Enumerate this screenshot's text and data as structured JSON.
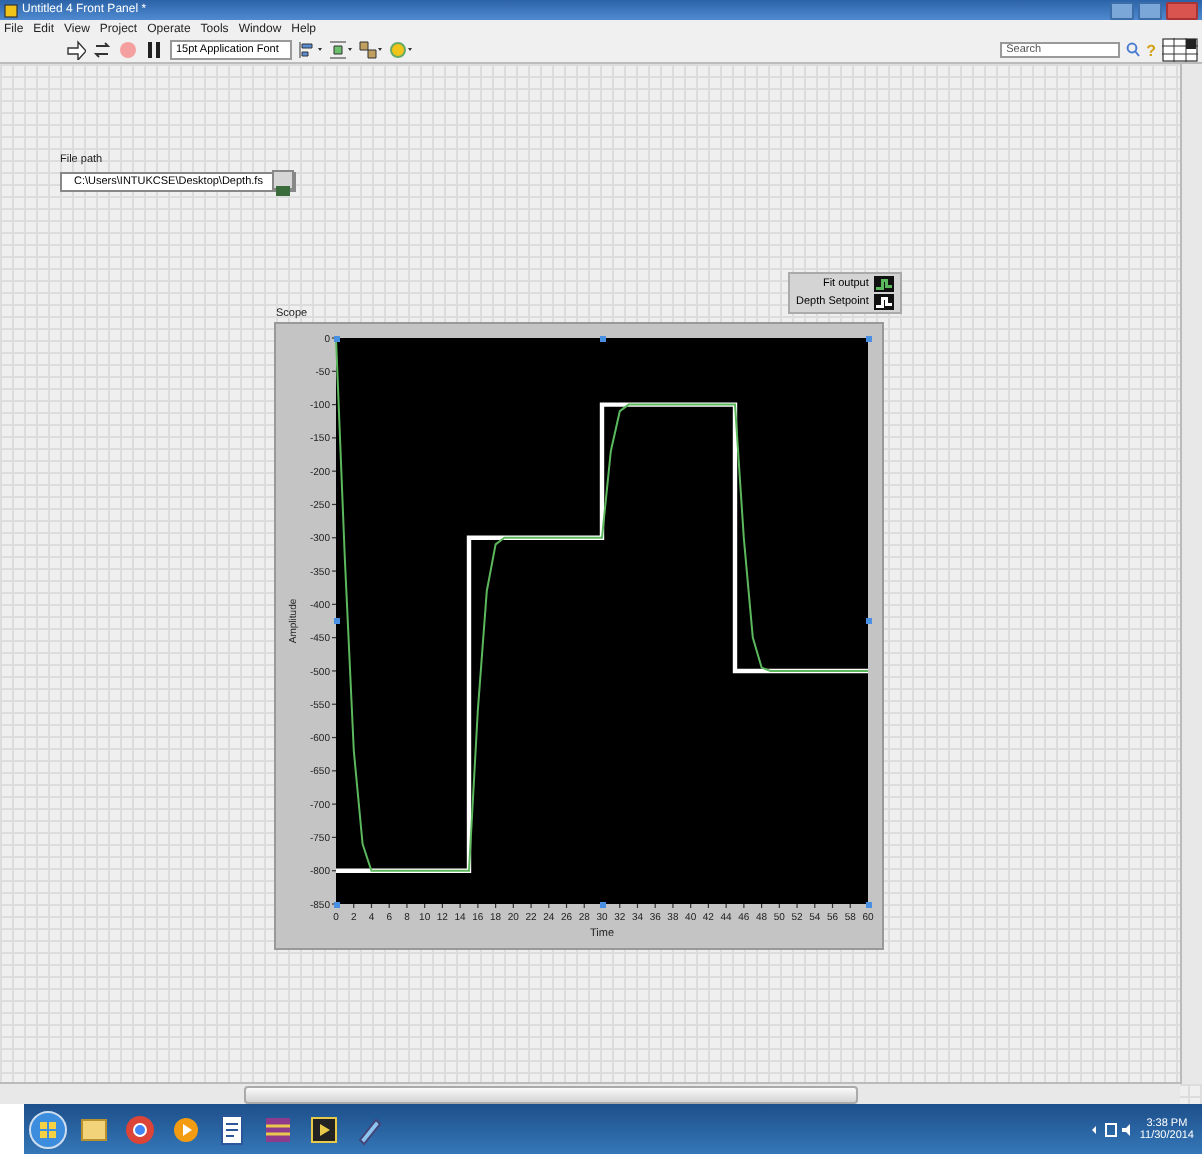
{
  "window": {
    "title": "Untitled 4 Front Panel *"
  },
  "menu": [
    "File",
    "Edit",
    "View",
    "Project",
    "Operate",
    "Tools",
    "Window",
    "Help"
  ],
  "toolbar": {
    "font": "15pt Application Font",
    "search": {
      "placeholder": "Search"
    },
    "help": "?"
  },
  "file_path": {
    "label": "File path",
    "value": "C:\\Users\\INTUKCSE\\Desktop\\Depth.fs"
  },
  "graph": {
    "chart_data": {
      "type": "line",
      "title": "Scope",
      "xlabel": "Time",
      "ylabel": "Amplitude",
      "x": [
        0,
        1,
        2,
        3,
        4,
        5,
        15,
        15,
        16,
        17,
        18,
        19,
        30,
        30,
        31,
        32,
        33,
        34,
        45,
        45,
        46,
        47,
        48,
        49,
        60
      ],
      "series": [
        {
          "name": "Fit output",
          "color": "#5cb85c",
          "values": [
            0,
            -330,
            -620,
            -760,
            -800,
            -800,
            -800,
            -800,
            -560,
            -380,
            -310,
            -300,
            -300,
            -300,
            -170,
            -110,
            -100,
            -100,
            -100,
            -100,
            -300,
            -450,
            -495,
            -500,
            -500
          ]
        },
        {
          "name": "Depth Setpoint",
          "color": "#ffffff",
          "values": [
            -800,
            -800,
            -800,
            -800,
            -800,
            -800,
            -800,
            -300,
            -300,
            -300,
            -300,
            -300,
            -300,
            -100,
            -100,
            -100,
            -100,
            -100,
            -100,
            -500,
            -500,
            -500,
            -500,
            -500,
            -500
          ]
        }
      ],
      "xlim": [
        0,
        60
      ],
      "ylim": [
        -850,
        0
      ],
      "xticks": [
        0,
        2,
        4,
        6,
        8,
        10,
        12,
        14,
        16,
        18,
        20,
        22,
        24,
        26,
        28,
        30,
        32,
        34,
        36,
        38,
        40,
        42,
        44,
        46,
        48,
        50,
        52,
        54,
        56,
        58,
        60
      ],
      "yticks": [
        0,
        -50,
        -100,
        -150,
        -200,
        -250,
        -300,
        -350,
        -400,
        -450,
        -500,
        -550,
        -600,
        -650,
        -700,
        -750,
        -800,
        -850
      ]
    }
  },
  "taskbar": {
    "time": "3:38 PM",
    "date": "11/30/2014"
  }
}
